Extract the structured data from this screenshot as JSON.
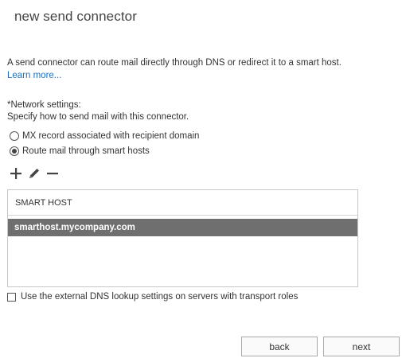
{
  "header": {
    "title": "new send connector"
  },
  "intro": {
    "text": "A send connector can route mail directly through DNS or redirect it to a smart host.",
    "link": "Learn more..."
  },
  "network": {
    "label": "*Network settings:",
    "description": "Specify how to send mail with this connector.",
    "options": [
      {
        "label": "MX record associated with recipient domain",
        "selected": false
      },
      {
        "label": "Route mail through smart hosts",
        "selected": true
      }
    ]
  },
  "toolbar": {
    "icons": [
      "add-icon",
      "edit-icon",
      "remove-icon"
    ]
  },
  "smart_hosts": {
    "column_header": "SMART HOST",
    "rows": [
      {
        "host": "smarthost.mycompany.com",
        "selected": true
      }
    ]
  },
  "dns_option": {
    "label": "Use the external DNS lookup settings on servers with transport roles",
    "checked": false
  },
  "buttons": {
    "back": "back",
    "next": "next"
  },
  "colors": {
    "link": "#1f6fbf",
    "selected_row": "#6f6f6f"
  }
}
